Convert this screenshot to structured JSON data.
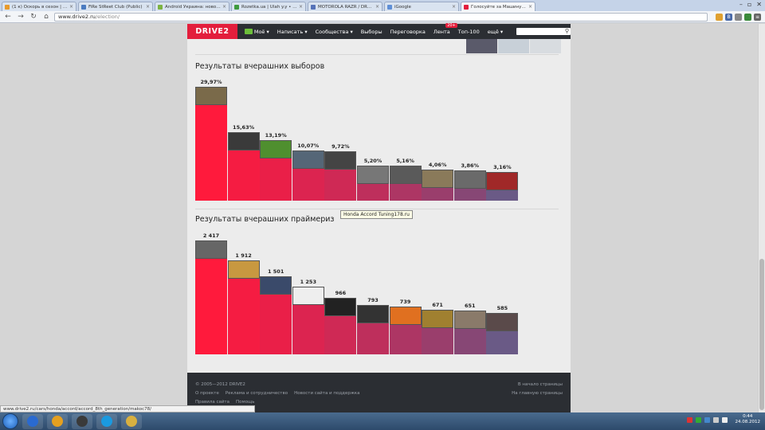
{
  "browser": {
    "tabs": [
      {
        "label": "(1 к) Оскорь в сезон | з-ц8 сериа...",
        "color": "#e89a2c",
        "active": false
      },
      {
        "label": "FiRe StReet Club (Public)",
        "color": "#4a7bc0",
        "active": false
      },
      {
        "label": "Android Украина: новости, ...",
        "color": "#7cb341",
        "active": false
      },
      {
        "label": "Rozetka.ua | Ulah y.y • microl...",
        "color": "#3e9a3e",
        "active": false
      },
      {
        "label": "MOTOROLA RAZR / DROID R...",
        "color": "#5572b8",
        "active": false
      },
      {
        "label": "iGoogle",
        "color": "#5f8fd6",
        "active": false
      },
      {
        "label": "Голосуйте за Машину дня",
        "color": "#e31e3c",
        "active": true
      }
    ],
    "url_host": "www.drive2.ru",
    "url_path": "/election/",
    "status_url": "www.drive2.ru/cars/honda/accord/accord_8th_generation/makoc78/"
  },
  "site": {
    "logo": "DRIVE2",
    "menu": [
      {
        "label": "Моё ▾",
        "has_car": true
      },
      {
        "label": "Написать ▾"
      },
      {
        "label": "Сообщества ▾"
      },
      {
        "label": "Выборы"
      },
      {
        "label": "Переговорка"
      },
      {
        "label": "Лента",
        "badge": "20+"
      },
      {
        "label": "Топ-100"
      },
      {
        "label": "ещё ▾"
      }
    ],
    "search_placeholder": ""
  },
  "elections": {
    "title": "Результаты вчерашних выборов",
    "values": [
      29.97,
      15.63,
      13.19,
      10.07,
      9.72,
      5.2,
      5.16,
      4.06,
      3.86,
      3.16
    ],
    "labels": [
      "29,97%",
      "15,63%",
      "13,19%",
      "10,07%",
      "9,72%",
      "5,20%",
      "5,16%",
      "4,06%",
      "3,86%",
      "3,16%"
    ]
  },
  "primaries": {
    "title": "Результаты вчерашних праймериз",
    "values": [
      2417,
      1912,
      1501,
      1253,
      966,
      793,
      739,
      671,
      651,
      585
    ],
    "labels": [
      "2 417",
      "1 912",
      "1 501",
      "1 253",
      "966",
      "793",
      "739",
      "671",
      "651",
      "585"
    ]
  },
  "tooltip": "Honda Accord Tuning178.ru",
  "bar_colors": [
    "#ff1a3c",
    "#f51c42",
    "#ea1f48",
    "#dc2450",
    "#cf2955",
    "#be2f5c",
    "#ad3664",
    "#9a3e6c",
    "#874775",
    "#6a5a86"
  ],
  "image_colors": [
    "#7a6a4a",
    "#3a3a3a",
    "#4f8f2f",
    "#556677",
    "#444444",
    "#777777",
    "#5a5a5a",
    "#8a7a5a",
    "#6a6a6a",
    "#a02828"
  ],
  "image_colors_b": [
    "#666666",
    "#c89840",
    "#3a4a6a",
    "#eeeeee",
    "#222222",
    "#333333",
    "#e07020",
    "#a08030",
    "#8a7a6a",
    "#5a4a4a"
  ],
  "footer": {
    "copyright": "© 2005—2012 DRIVE2",
    "links_row1": [
      "О проекте",
      "Реклама и сотрудничество",
      "Новости сайта и поддержка"
    ],
    "links_row2": [
      "Правила сайта",
      "Помощь"
    ],
    "right_links": [
      "В начало страницы",
      "На главную страницы"
    ]
  },
  "taskbar": {
    "apps": [
      "#2a6ad0",
      "#e5a020",
      "#3a3a3a",
      "#1a9ae0",
      "#d8b040"
    ],
    "clock_time": "0:44",
    "clock_date": "24.08.2012"
  }
}
